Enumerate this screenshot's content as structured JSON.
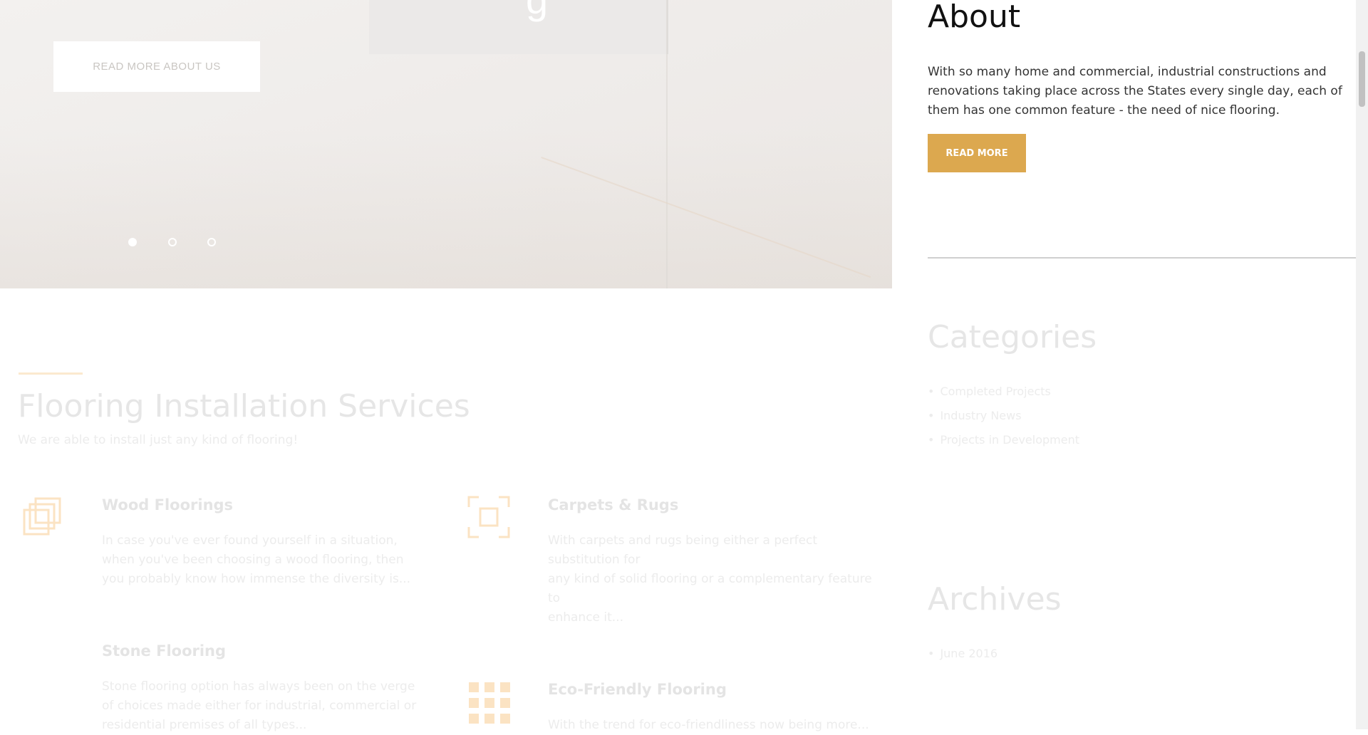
{
  "hero": {
    "slide_heading_fragment": "g",
    "cta_label": "READ MORE ABOUT US",
    "slides": [
      "slide-1",
      "slide-2",
      "slide-3"
    ],
    "active_slide": 1
  },
  "sidebar": {
    "about": {
      "title": "About",
      "text": "With so many home and commercial, industrial constructions and renovations taking place across the States every single day, each of them has one common feature - the need of nice flooring.",
      "button_label": "READ MORE"
    },
    "categories": {
      "title": "Categories",
      "items": [
        "Completed Projects",
        "Industry News",
        "Projects in Development"
      ]
    },
    "archives": {
      "title": "Archives",
      "items": [
        "June 2016"
      ]
    }
  },
  "services": {
    "title": "Flooring Installation Services",
    "subtitle": "We are able to install just any kind of flooring!",
    "items": [
      {
        "name": "Wood Floorings",
        "icon": "stacked-squares-icon",
        "description": "In case you've ever found yourself in a situation, when you've been choosing a wood flooring, then you probably know how immense the diversity is..."
      },
      {
        "name": "Carpets & Rugs",
        "icon": "framed-square-icon",
        "description_lines": [
          "With carpets and rugs being either a perfect substitution for",
          "any kind of solid flooring or a complementary feature to",
          "enhance it..."
        ]
      },
      {
        "name": "Stone Flooring",
        "icon": "",
        "description": "Stone flooring option has always been on the verge of choices made either for industrial, commercial or residential premises of all types..."
      },
      {
        "name": "Eco-Friendly Flooring",
        "icon": "tile-grid-icon",
        "description": "With the trend for eco-friendliness now being more..."
      }
    ]
  },
  "colors": {
    "accent": "#dca84f",
    "faded_accent": "#fbe9cf",
    "heading_dark": "#111111"
  }
}
